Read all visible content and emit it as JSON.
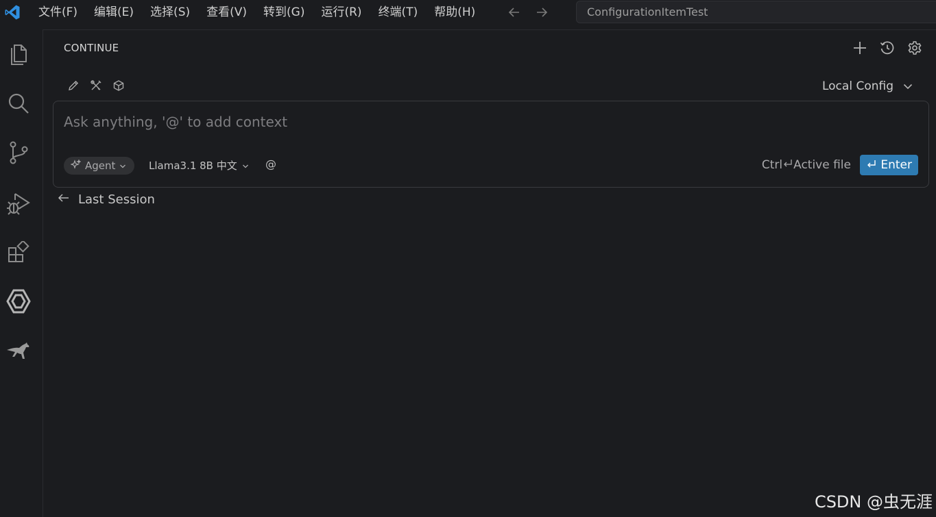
{
  "menu": [
    "文件(F)",
    "编辑(E)",
    "选择(S)",
    "查看(V)",
    "转到(G)",
    "运行(R)",
    "终端(T)",
    "帮助(H)"
  ],
  "search": {
    "value": "ConfigurationItemTest"
  },
  "activity": [
    "files-icon",
    "search-icon",
    "source-control-icon",
    "run-debug-icon",
    "extensions-icon",
    "continue-icon",
    "kangaroo-icon"
  ],
  "panel": {
    "title": "CONTINUE",
    "config_label": "Local Config"
  },
  "chat": {
    "placeholder": "Ask anything, '@' to add context",
    "mode_label": "Agent",
    "model_label": "Llama3.1 8B 中文",
    "at_label": "@",
    "shortcut_prefix": "Ctrl",
    "shortcut_label": "Active file",
    "enter_label": "Enter"
  },
  "history": {
    "last_session": "Last Session"
  },
  "watermark": "CSDN @虫无涯",
  "colors": {
    "accent": "#2e7bb2",
    "vscode_blue": "#2f8fe0",
    "background": "#1b1c1f"
  }
}
